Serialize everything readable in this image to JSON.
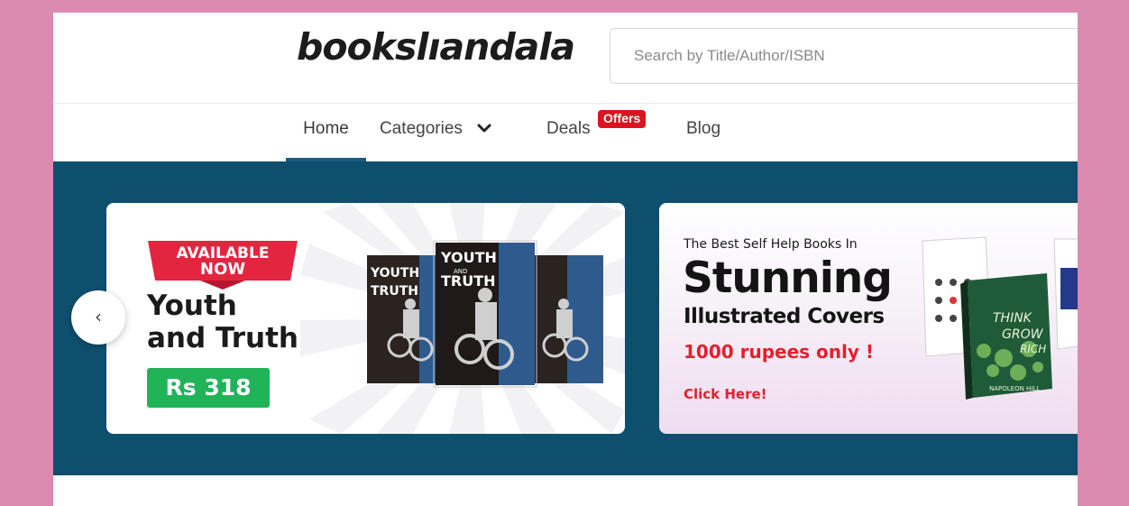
{
  "header": {
    "logo_text": "bookslıandala",
    "search_placeholder": "Search by Title/Author/ISBN"
  },
  "nav": {
    "items": [
      {
        "label": "Home",
        "active": true
      },
      {
        "label": "Categories",
        "icon": "chevron-down-icon"
      },
      {
        "label": "Deals",
        "badge": "Offers"
      },
      {
        "label": "Blog"
      }
    ]
  },
  "hero": {
    "prev_button": "‹",
    "banner1": {
      "ribbon_line1": "AVAILABLE",
      "ribbon_line2": "NOW",
      "title_line1": "Youth",
      "title_line2": "and Truth",
      "price": "Rs 318",
      "book_cover_title_line1": "YOUTH",
      "book_cover_title_line2": "AND",
      "book_cover_title_line3": "TRUTH"
    },
    "banner2": {
      "eyebrow": "The Best Self Help Books In",
      "title": "Stunning",
      "subtitle": "Illustrated Covers",
      "price_text": "1000 rupees only !",
      "cta": "Click Here!",
      "book_front_title_line1": "THINK",
      "book_front_title_line2": "GROW",
      "book_front_title_line3": "RICH",
      "book_front_author": "NAPOLEON HILL"
    }
  },
  "colors": {
    "page_frame": "#db8ab0",
    "hero_background": "#0f4f6e",
    "nav_active_underline": "#1b5b82",
    "offers_badge": "#d9141d",
    "price_badge": "#20b358",
    "accent_red": "#e4202d"
  }
}
